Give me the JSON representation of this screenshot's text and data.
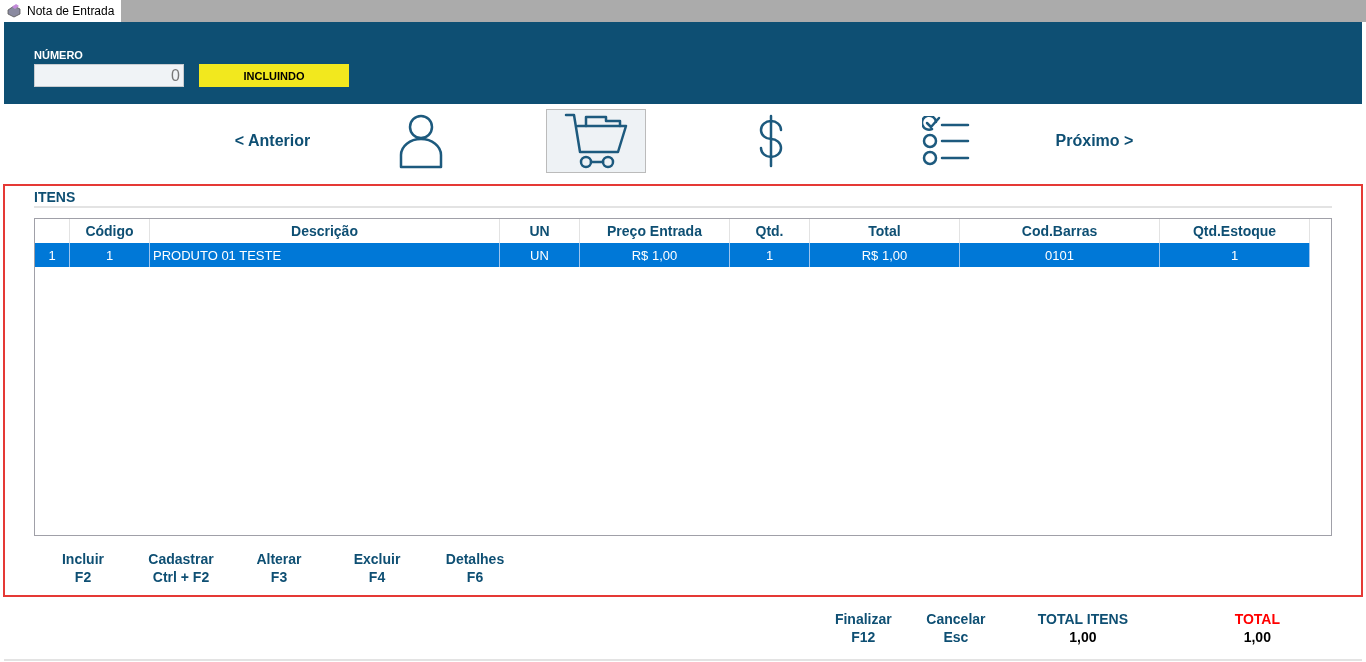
{
  "window": {
    "tab": "Nota de Entrada"
  },
  "header": {
    "numero_label": "NÚMERO",
    "numero_value": "0",
    "status": "INCLUINDO"
  },
  "nav": {
    "previous": "< Anterior",
    "next": "Próximo >",
    "steps": [
      {
        "kind": "person",
        "selected": false
      },
      {
        "kind": "cart",
        "selected": true
      },
      {
        "kind": "dollar",
        "selected": false
      },
      {
        "kind": "checklist",
        "selected": false
      }
    ]
  },
  "items": {
    "title": "ITENS",
    "table": {
      "columns": [
        "",
        "Código",
        "Descrição",
        "UN",
        "Preço Entrada",
        "Qtd.",
        "Total",
        "Cod.Barras",
        "Qtd.Estoque"
      ],
      "rows": [
        {
          "cells": [
            "1",
            "1",
            "PRODUTO 01 TESTE",
            "UN",
            "R$ 1,00",
            "1",
            "R$ 1,00",
            "0101",
            "1"
          ],
          "selected": true
        }
      ]
    },
    "actions": [
      {
        "label": "Incluir",
        "key": "F2"
      },
      {
        "label": "Cadastrar",
        "key": "Ctrl + F2"
      },
      {
        "label": "Alterar",
        "key": "F3"
      },
      {
        "label": "Excluir",
        "key": "F4"
      },
      {
        "label": "Detalhes",
        "key": "F6"
      }
    ]
  },
  "footer": {
    "actions": [
      {
        "label": "Finalizar",
        "key": "F12"
      },
      {
        "label": "Cancelar",
        "key": "Esc"
      }
    ],
    "totals": [
      {
        "label": "TOTAL ITENS",
        "value": "1,00",
        "kind": "normal"
      },
      {
        "label": "TOTAL",
        "value": "1,00",
        "kind": "highlight"
      }
    ]
  }
}
